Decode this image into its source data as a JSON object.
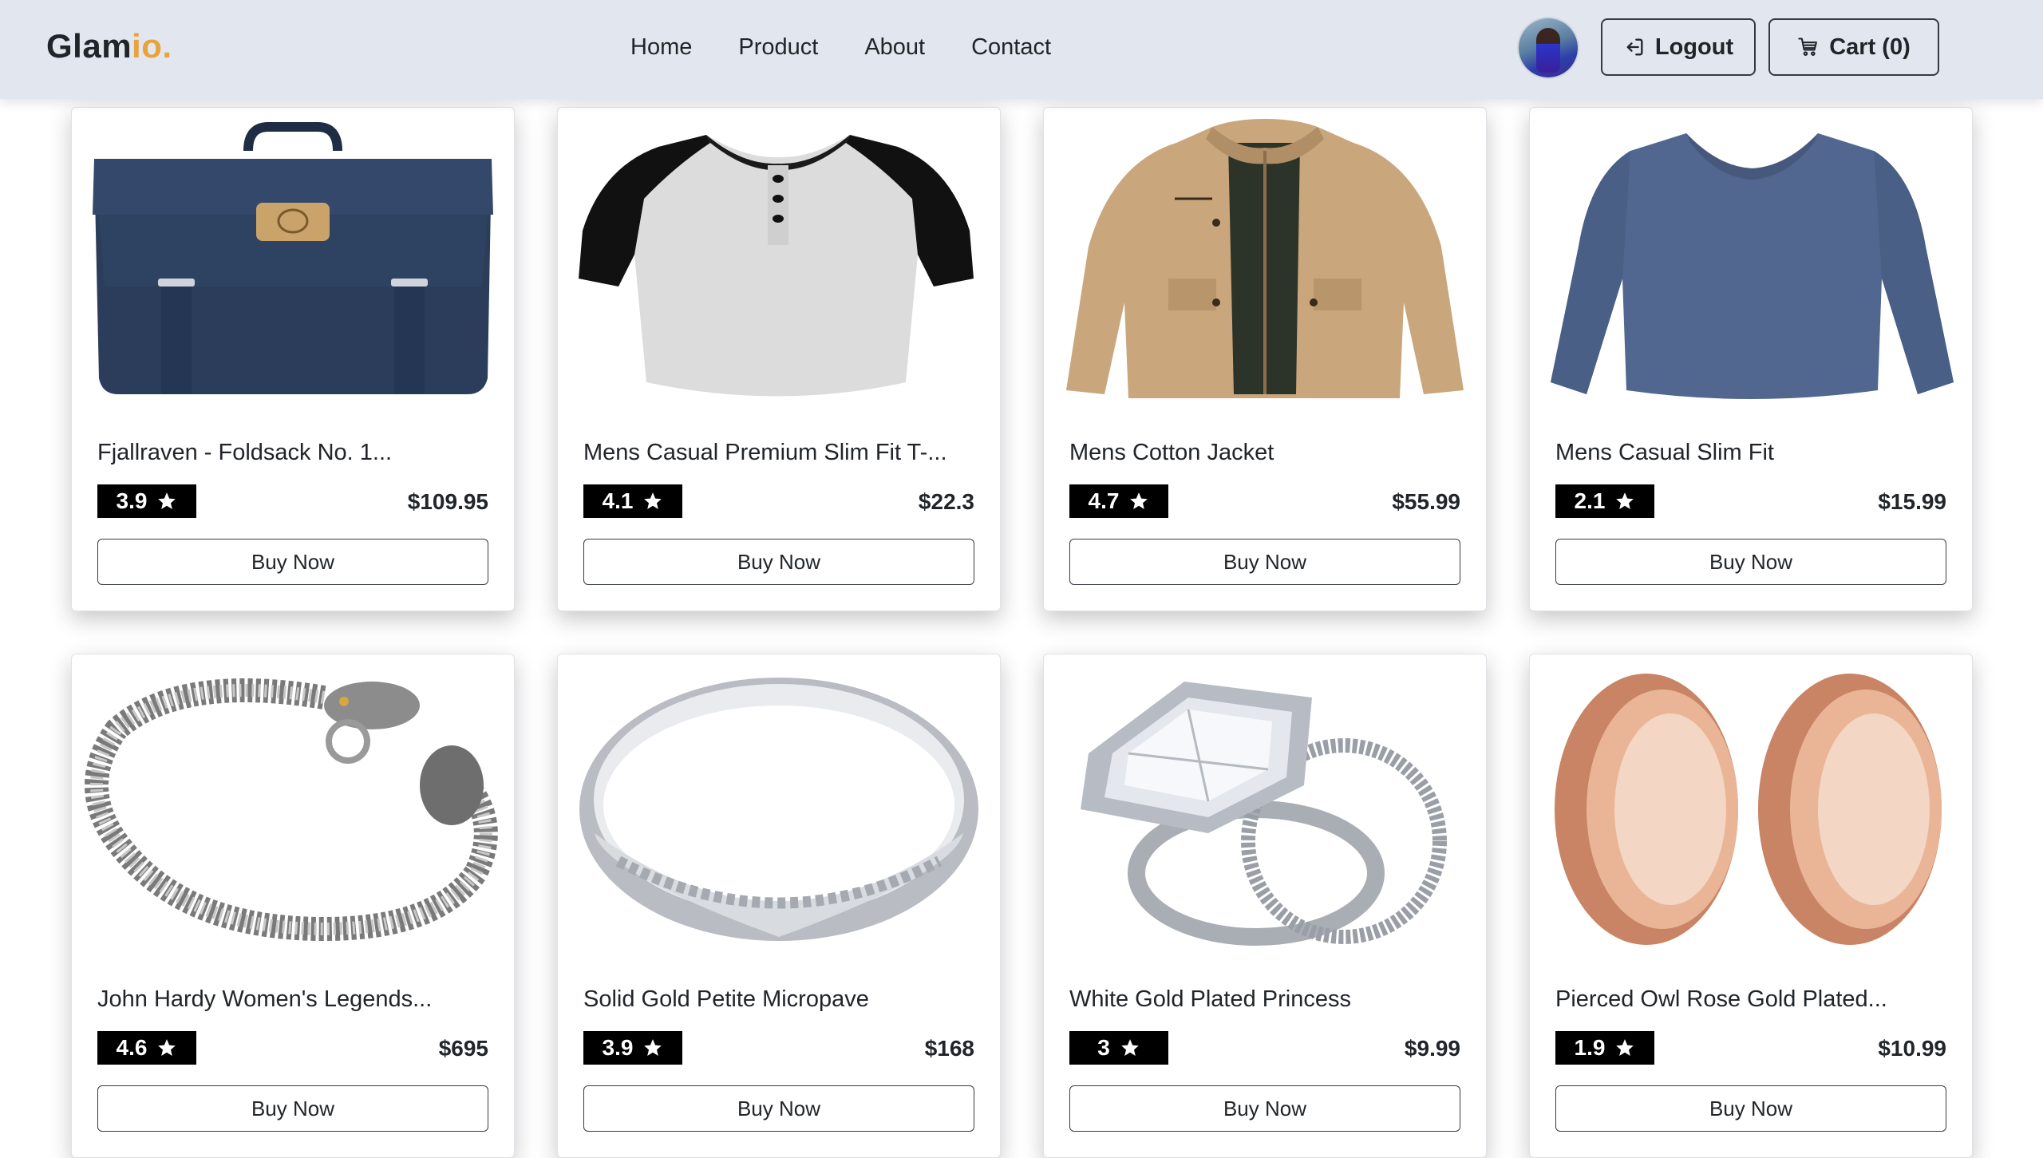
{
  "brand": {
    "name": "Glam",
    "accent": "io."
  },
  "nav": {
    "links": [
      "Home",
      "Product",
      "About",
      "Contact"
    ]
  },
  "header": {
    "logout_label": "Logout",
    "cart_label": "Cart (0)"
  },
  "colors": {
    "navbar_bg": "#e2e7ef",
    "brand_accent": "#e8a33d",
    "badge_bg": "#000000",
    "badge_text": "#ffffff"
  },
  "products": [
    {
      "title": "Fjallraven - Foldsack No. 1...",
      "rating": "3.9",
      "price": "$109.95",
      "button": "Buy Now",
      "image": "navy-backpack"
    },
    {
      "title": "Mens Casual Premium Slim Fit T-...",
      "rating": "4.1",
      "price": "$22.3",
      "button": "Buy Now",
      "image": "raglan-henley-tshirt"
    },
    {
      "title": "Mens Cotton Jacket",
      "rating": "4.7",
      "price": "$55.99",
      "button": "Buy Now",
      "image": "khaki-jacket"
    },
    {
      "title": "Mens Casual Slim Fit",
      "rating": "2.1",
      "price": "$15.99",
      "button": "Buy Now",
      "image": "blue-longsleeve-shirt"
    },
    {
      "title": "John Hardy Women's Legends...",
      "rating": "4.6",
      "price": "$695",
      "button": "Buy Now",
      "image": "dragon-chain-bracelet"
    },
    {
      "title": "Solid Gold Petite Micropave",
      "rating": "3.9",
      "price": "$168",
      "button": "Buy Now",
      "image": "silver-band-ring"
    },
    {
      "title": "White Gold Plated Princess",
      "rating": "3",
      "price": "$9.99",
      "button": "Buy Now",
      "image": "diamond-ring-set"
    },
    {
      "title": "Pierced Owl Rose Gold Plated...",
      "rating": "1.9",
      "price": "$10.99",
      "button": "Buy Now",
      "image": "rose-gold-plugs"
    }
  ]
}
